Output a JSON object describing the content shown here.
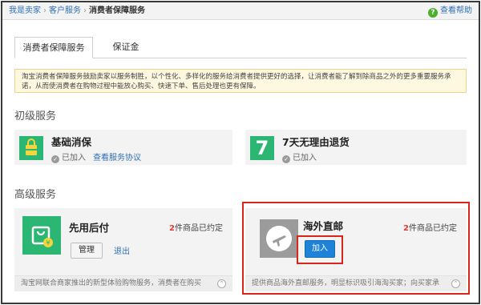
{
  "breadcrumb": {
    "items": [
      "我是卖家",
      "客户服务"
    ],
    "current": "消费者保障服务"
  },
  "help": {
    "label": "查看帮助"
  },
  "tabs": [
    {
      "label": "消费者保障服务",
      "active": true
    },
    {
      "label": "保证金",
      "active": false
    }
  ],
  "notice": "淘宝消费者保障服务鼓励卖家以服务制胜，以个性化、多样化的服务给消费者提供更好的选择，让消费者能了解到除商品之外的更多重要服务承诺，从而使消费者在购物过程中能放心购买、快速下单、售后处理也更有保障。",
  "basic": {
    "title": "初级服务",
    "cards": [
      {
        "name": "基础消保",
        "status": "已加入",
        "link": "查看服务协议",
        "icon": "bag-icon"
      },
      {
        "name": "7天无理由退货",
        "status": "已加入",
        "icon_text": "7",
        "icon": "seven-day-icon"
      }
    ]
  },
  "advanced": {
    "title": "高级服务",
    "cards": [
      {
        "name": "先用后付",
        "count": "2",
        "count_suffix": "件商品已约定",
        "btn_manage": "管理",
        "btn_exit": "退出",
        "desc": "淘宝网联合商家推出的新型体验购物服务，消费者在购买",
        "icon": "shopping-bag-yen-icon"
      },
      {
        "name": "海外直邮",
        "count": "2",
        "count_suffix": "件商品已约定",
        "btn_join": "加入",
        "desc": "提供商品海外直邮服务，明显标识吸引海淘买家；向买家承",
        "icon": "airplane-icon"
      }
    ]
  },
  "colors": {
    "accent": "#2bb673",
    "link": "#2f6fb6",
    "highlight": "#d9251c",
    "button": "#1d82d8"
  }
}
